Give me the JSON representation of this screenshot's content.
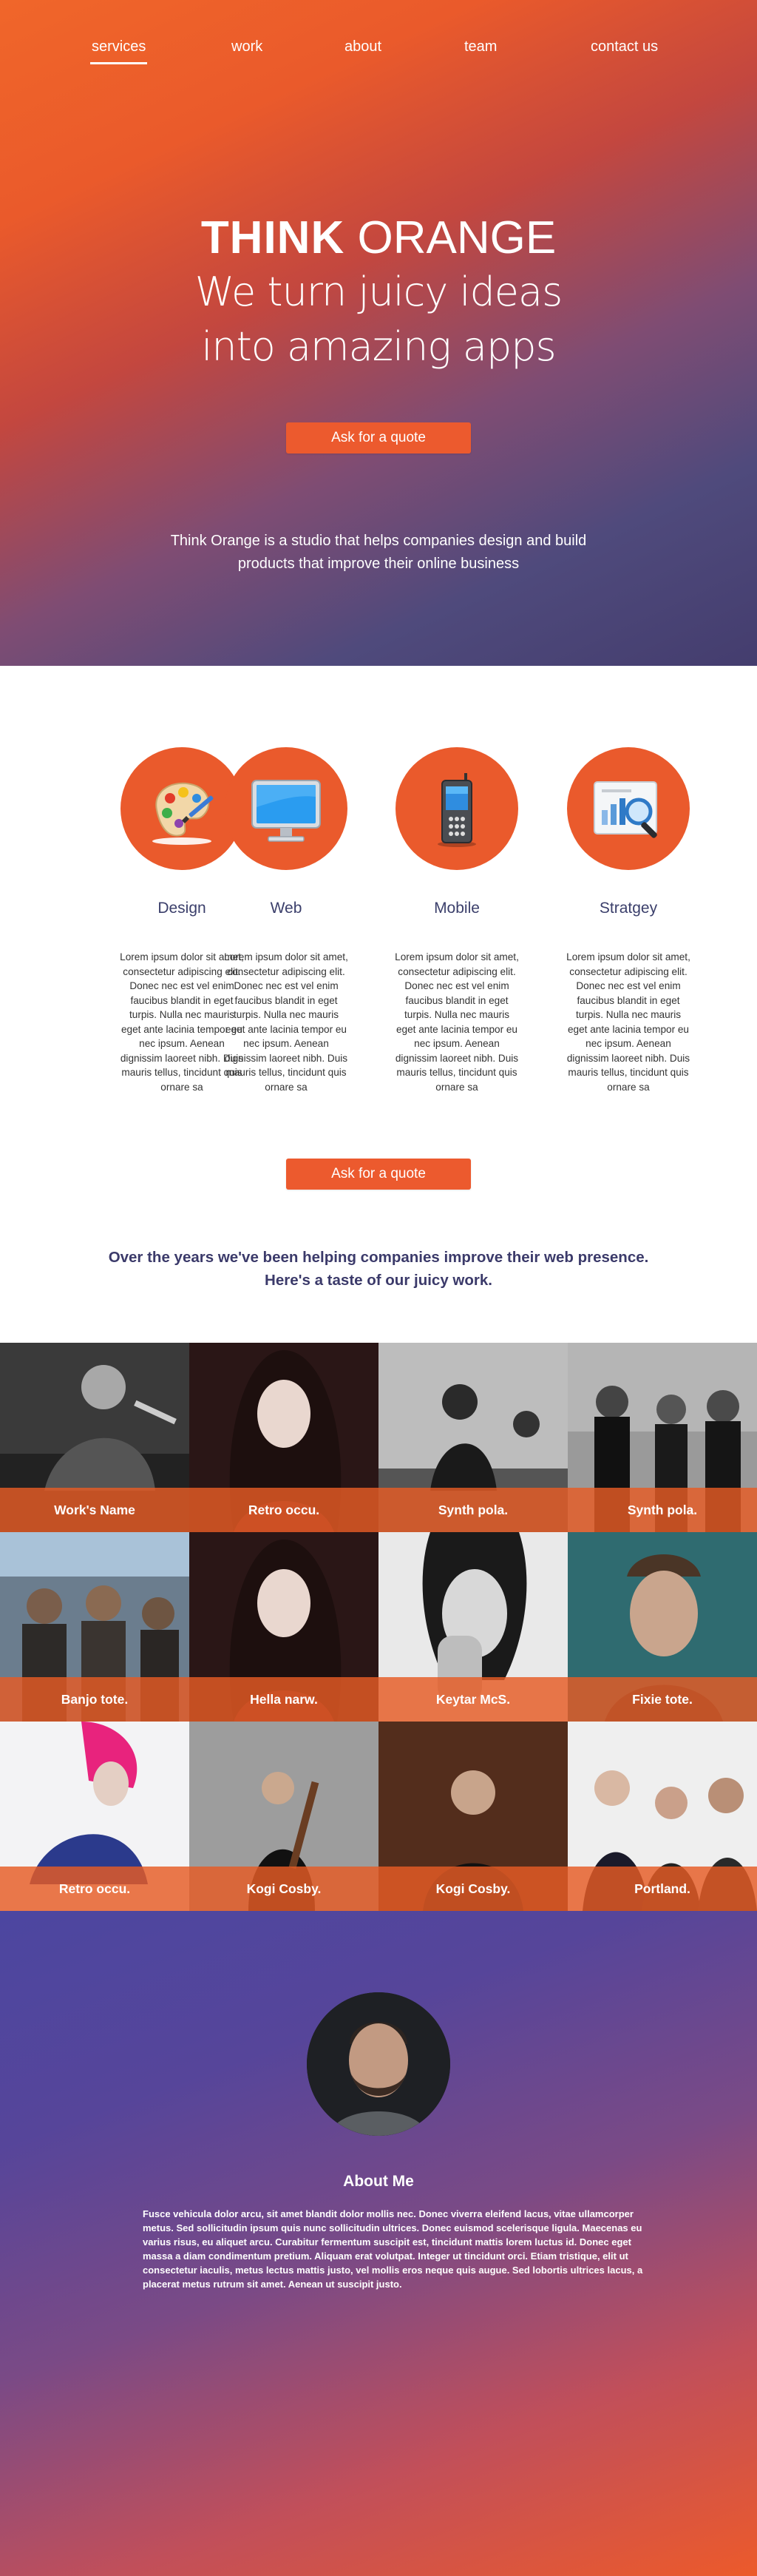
{
  "nav": {
    "items": [
      {
        "label": "services",
        "active": true
      },
      {
        "label": "work",
        "active": false
      },
      {
        "label": "about",
        "active": false
      },
      {
        "label": "team",
        "active": false
      },
      {
        "label": "contact us",
        "active": false
      }
    ]
  },
  "hero": {
    "title_bold": "THINK",
    "title_light": "ORANGE",
    "subtitle_line1": "We turn juicy ideas",
    "subtitle_line2": "into amazing apps",
    "cta_label": "Ask for a quote",
    "description": "Think Orange is a studio that helps companies design and build products that improve their online business"
  },
  "services": {
    "items": [
      {
        "name": "Design",
        "icon": "palette-icon",
        "text": "Lorem ipsum dolor sit amet, consectetur adipiscing elit. Donec nec est vel enim faucibus blandit in eget turpis. Nulla nec mauris eget ante lacinia tempor eu nec ipsum. Aenean dignissim laoreet nibh. Duis mauris tellus, tincidunt quis ornare sa"
      },
      {
        "name": "Web",
        "icon": "monitor-icon",
        "text": "Lorem ipsum dolor sit amet, consectetur adipiscing elit. Donec nec est vel enim faucibus blandit in eget turpis. Nulla nec mauris eget ante lacinia tempor eu nec ipsum. Aenean dignissim laoreet nibh. Duis mauris tellus, tincidunt quis ornare sa"
      },
      {
        "name": "Mobile",
        "icon": "phone-icon",
        "text": "Lorem ipsum dolor sit amet, consectetur adipiscing elit. Donec nec est vel enim faucibus blandit in eget turpis. Nulla nec mauris eget ante lacinia tempor eu nec ipsum. Aenean dignissim laoreet nibh. Duis mauris tellus, tincidunt quis ornare sa"
      },
      {
        "name": "Stratgey",
        "icon": "analytics-icon",
        "text": "Lorem ipsum dolor sit amet, consectetur adipiscing elit. Donec nec est vel enim faucibus blandit in eget turpis. Nulla nec mauris eget ante lacinia tempor eu nec ipsum. Aenean dignissim laoreet nibh. Duis mauris tellus, tincidunt quis ornare sa"
      }
    ],
    "cta_label": "Ask for a quote",
    "intro_line1": "Over the years we've been helping companies improve their web presence.",
    "intro_line2": "Here's a taste of our juicy work."
  },
  "portfolio": {
    "items": [
      {
        "name": "Work's Name"
      },
      {
        "name": "Retro occu."
      },
      {
        "name": "Synth pola."
      },
      {
        "name": "Synth pola."
      },
      {
        "name": "Banjo tote."
      },
      {
        "name": "Hella narw."
      },
      {
        "name": "Keytar McS."
      },
      {
        "name": "Fixie tote."
      },
      {
        "name": "Retro occu."
      },
      {
        "name": "Kogi Cosby."
      },
      {
        "name": "Kogi Cosby."
      },
      {
        "name": "Portland."
      }
    ]
  },
  "about": {
    "title": "About Me",
    "text": "Fusce vehicula dolor arcu, sit amet blandit dolor mollis nec. Donec viverra eleifend lacus, vitae ullamcorper metus. Sed sollicitudin ipsum quis nunc sollicitudin ultrices. Donec euismod scelerisque ligula. Maecenas eu varius risus, eu aliquet arcu. Curabitur fermentum suscipit est, tincidunt mattis lorem luctus id. Donec eget massa a diam condimentum pretium. Aliquam erat volutpat. Integer ut tincidunt orci. Etiam tristique, elit ut consectetur iaculis, metus lectus mattis justo, vel mollis eros neque quis augue. Sed lobortis ultrices lacus, a placerat metus rutrum sit amet. Aenean ut suscipit justo."
  },
  "colors": {
    "accent": "#ea5a2c",
    "navy_text": "#3b3f6b",
    "hero_top": "#f0662a",
    "hero_bottom": "#443d6e",
    "about_top": "#4c46a0",
    "about_bottom": "#ec5a2b"
  }
}
